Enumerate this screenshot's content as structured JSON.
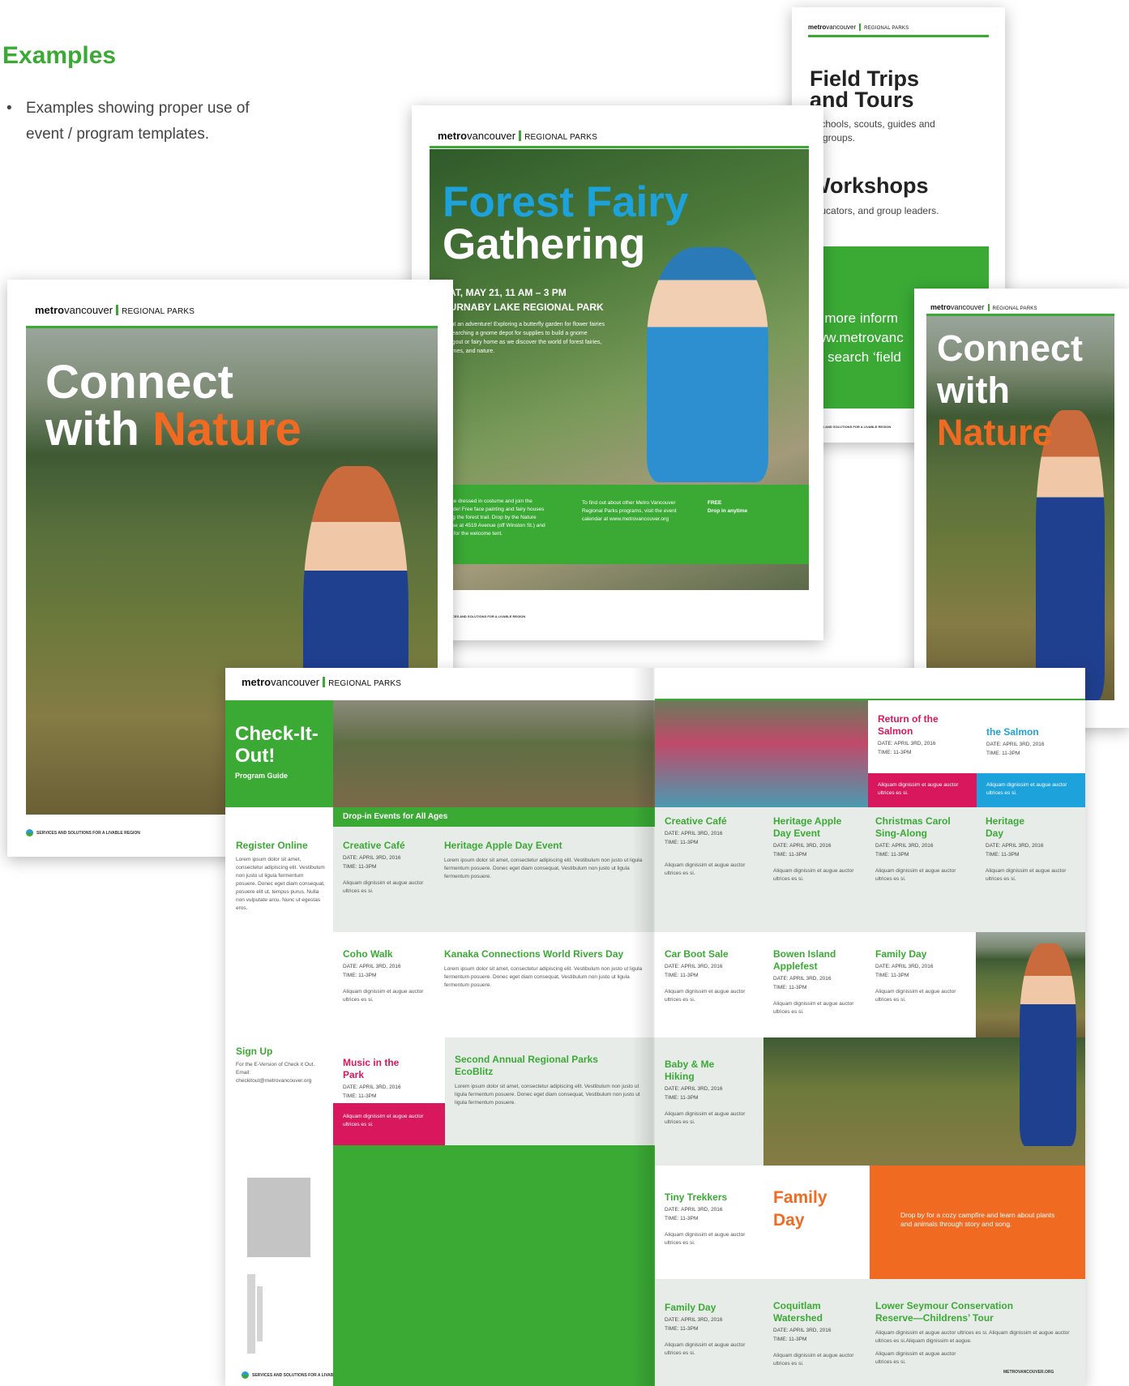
{
  "page": {
    "heading": "Examples",
    "bullet": "Examples showing proper use of event / program templates."
  },
  "brand": {
    "metro": "metro",
    "vancouver": "vancouver",
    "regional_parks": "REGIONAL PARKS"
  },
  "footer": {
    "tagline": "SERVICES AND SOLUTIONS FOR A LIVABLE REGION",
    "url": "METROVANCOUVER.ORG"
  },
  "field_trips": {
    "title1": "Field Trips",
    "title2": "and Tours",
    "sub1": "r schools, scouts, guides and",
    "sub1b": "ult groups.",
    "title3": "Workshops",
    "sub2": "educators, and group leaders.",
    "more1": "r more inform",
    "more2": "ww.metrovanc",
    "more3": "d search ‘field"
  },
  "forest": {
    "title1": "Forest Fairy",
    "title2": "Gathering",
    "date": "SAT, MAY 21, 11 AM – 3 PM",
    "place": "BURNABY LAKE REGIONAL PARK",
    "desc": "What an adventure! Exploring a butterfly garden for flower fairies or searching a gnome depot for supplies to build a gnome hangout or fairy home as we discover the world of forest fairies, gnomes, and nature.",
    "col1": "Come dressed in costume and join the parade! Free face painting and fairy houses along the forest trail. Drop by the Nature House at 4519 Avenue (off Winston St.) and look for the welcome tent.",
    "col2": "To find out about other Metro Vancouver Regional Parks programs, visit the event calendar at www.metrovancouver.org",
    "col3a": "FREE",
    "col3b": "Drop in anytime"
  },
  "connect": {
    "line1": "Connect",
    "line2a": "with ",
    "line2b": "Nature"
  },
  "connect_small": {
    "line1": "Connect",
    "line2": "with",
    "line3": "Nature"
  },
  "guide": {
    "title": "Check-It-Out!",
    "subtitle": "Program Guide",
    "register": "Register Online",
    "register_text": "Lorem ipsum dolor sit amet, consectetur adipiscing elit. Vestibulum non justo ut ligula fermentum posuere. Donec eget diam consequat, posuere elit ut, tempus purus. Nulla non vulputate arcu. Nunc ut egestas eros.",
    "signup": "Sign Up",
    "signup_text": "For the E-Version of Check it Out. Email: checkitout@metrovancouver.org",
    "dropin": "Drop-in Events for All Ages",
    "date": "DATE: APRIL 3RD, 2016",
    "time": "TIME: 11-3PM",
    "aliquam": "Aliquam dignissim et augue auctor ultrices es si.",
    "lorem": "Lorem ipsum dolor sit amet, consectetur adipiscing elit. Vestibulum non justo ut ligula fermentum posuere. Donec eget diam consequat, Vestibulum non justo ut ligula fermentum posuere.",
    "lower_text": "Aliquam dignissim et augue auctor ultrices es si. Aliquam dignissim et augue auctor ultrices es si.Aliquam dignissim et augue.",
    "campfire": "Drop by for a cozy campfire and learn about plants and animals through story and song.",
    "events": {
      "creative_cafe": "Creative Café",
      "heritage_apple_day_event": "Heritage Apple Day Event",
      "coho_walk": "Coho Walk",
      "kanaka": "Kanaka Connections World Rivers Day",
      "music_park": "Music in the Park",
      "ecoblitz": "Second Annual Regional Parks EcoBlitz",
      "return_salmon_a": "Return of the Salmon",
      "return_salmon_b": "the Salmon",
      "heritage_apple_day_event_r": "Heritage Apple Day Event",
      "christmas": "Christmas Carol Sing-Along",
      "heritage_day": "Heritage Day",
      "car_boot": "Car Boot Sale",
      "bowen": "Bowen Island Applefest",
      "family_day": "Family Day",
      "baby_hiking": "Baby & Me Hiking",
      "tiny_trekkers": "Tiny Trekkers",
      "family_day_big": "Family Day",
      "family_day_b": "Family Day",
      "coquitlam": "Coquitlam Watershed",
      "lower_seymour": "Lower Seymour Conservation Reserve—Childrens’ Tour"
    }
  },
  "colors": {
    "green": "#3aaa35",
    "blue": "#1ea2dc",
    "orange": "#f06a22",
    "magenta": "#d8175c",
    "light": "#e8ece9"
  }
}
